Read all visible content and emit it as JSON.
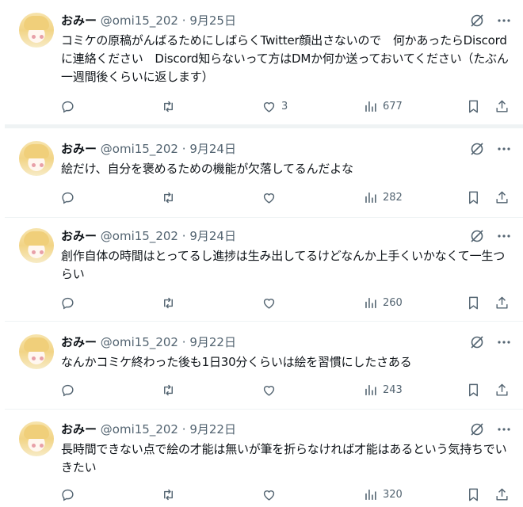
{
  "tweets": [
    {
      "name": "おみー",
      "handle": "@omi15_202",
      "dot": "·",
      "date": "9月25日",
      "text": "コミケの原稿がんばるためにしばらくTwitter顔出さないので　何かあったらDiscordに連絡ください　Discord知らないって方はDMか何か送っておいてください（たぶん一週間後くらいに返します）",
      "likes": "3",
      "views": "677"
    },
    {
      "name": "おみー",
      "handle": "@omi15_202",
      "dot": "·",
      "date": "9月24日",
      "text": "絵だけ、自分を褒めるための機能が欠落してるんだよな",
      "likes": "",
      "views": "282"
    },
    {
      "name": "おみー",
      "handle": "@omi15_202",
      "dot": "·",
      "date": "9月24日",
      "text": "創作自体の時間はとってるし進捗は生み出してるけどなんか上手くいかなくて一生つらい",
      "likes": "",
      "views": "260"
    },
    {
      "name": "おみー",
      "handle": "@omi15_202",
      "dot": "·",
      "date": "9月22日",
      "text": "なんかコミケ終わった後も1日30分くらいは絵を習慣にしたさある",
      "likes": "",
      "views": "243"
    },
    {
      "name": "おみー",
      "handle": "@omi15_202",
      "dot": "·",
      "date": "9月22日",
      "text": "長時間できない点で絵の才能は無いが筆を折らなければ才能はあるという気持ちでいきたい",
      "likes": "",
      "views": "320"
    }
  ],
  "icons": {
    "reply": "reply-icon",
    "retweet": "retweet-icon",
    "like": "heart-icon",
    "views": "views-icon",
    "bookmark": "bookmark-icon",
    "share": "share-icon",
    "grok": "grok-icon",
    "more": "more-icon"
  },
  "colors": {
    "text": "#0f1419",
    "secondary": "#536471",
    "divider": "#eff3f4"
  }
}
